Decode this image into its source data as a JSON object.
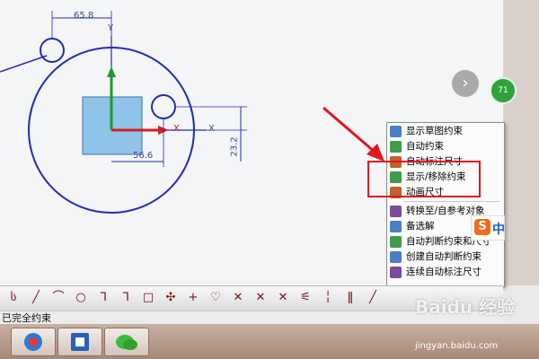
{
  "sketch": {
    "dim_horizontal": "65.8",
    "dim_small": "56.6",
    "dim_vertical": "23.2",
    "axis_x": "X",
    "axis_y": "Y",
    "axis_x2": "X"
  },
  "overlay": {
    "nav_arrow": "›",
    "badge": "71"
  },
  "context_menu": {
    "items": [
      {
        "label": "显示草图约束",
        "icon_color": "#4a7fc8"
      },
      {
        "label": "自动约束",
        "icon_color": "#3f9a4a"
      },
      {
        "label": "自动标注尺寸",
        "icon_color": "#c0622a"
      },
      {
        "label": "显示/移除约束",
        "icon_color": "#3f9a4a"
      },
      {
        "label": "动画尺寸",
        "icon_color": "#c0622a"
      },
      {
        "label": "转换至/自参考对象",
        "icon_color": "#7a4a9c"
      },
      {
        "label": "备选解",
        "icon_color": "#4a7fc8"
      },
      {
        "label": "自动判断约束和尺寸",
        "icon_color": "#3f9a4a"
      },
      {
        "label": "创建自动判断约束",
        "icon_color": "#4a7fc8"
      },
      {
        "label": "连续自动标注尺寸",
        "icon_color": "#7a4a9c"
      }
    ]
  },
  "toolbar": {
    "tools": [
      "ს",
      "╱",
      "⌒",
      "○",
      "ᒣ",
      "ᒣ",
      "□",
      "✣",
      "+",
      "♡",
      "✕",
      "✕",
      "✕",
      "⚟",
      "╎",
      "ǁ",
      "╱"
    ]
  },
  "status_bar": {
    "text": "已完全约束"
  },
  "ime": {
    "char": "中",
    "logo": "S"
  },
  "watermark": {
    "brand": "Baidu 经验",
    "url": "jingyan.baidu.com"
  },
  "colors": {
    "highlight": "#e3161d",
    "sketch_line": "#1f2db5",
    "square_fill": "#8fc4e8"
  }
}
